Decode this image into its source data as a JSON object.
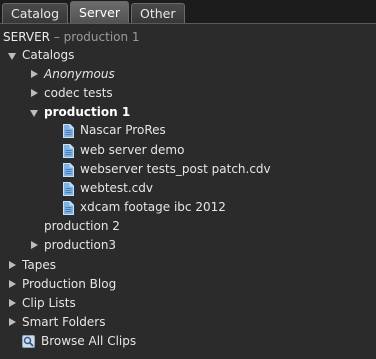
{
  "tabs": [
    {
      "label": "Catalog"
    },
    {
      "label": "Server"
    },
    {
      "label": "Other"
    }
  ],
  "active_tab": "Server",
  "server": {
    "label": "SERVER",
    "separator": "–",
    "name": "production 1"
  },
  "tree": {
    "catalogs": {
      "label": "Catalogs",
      "items": {
        "anonymous": "Anonymous",
        "codec_tests": "codec tests",
        "production1": {
          "label": "production 1",
          "files": [
            "Nascar ProRes",
            "web server demo",
            "webserver tests_post patch.cdv",
            "webtest.cdv",
            "xdcam footage ibc 2012"
          ]
        },
        "production2": "production 2",
        "production3": "production3"
      }
    },
    "tapes": "Tapes",
    "production_blog": "Production Blog",
    "clip_lists": "Clip Lists",
    "smart_folders": "Smart Folders",
    "browse_all_clips": "Browse All Clips"
  },
  "icons": {
    "expand_collapsed": "triangle-right-icon",
    "expand_open": "triangle-down-icon",
    "file": "document-icon",
    "browse": "magnifier-icon"
  },
  "colors": {
    "background": "#2b2b2b",
    "text": "#e6e6e6",
    "muted": "#9a9a9a",
    "doc_icon": "#7fb2e5"
  }
}
